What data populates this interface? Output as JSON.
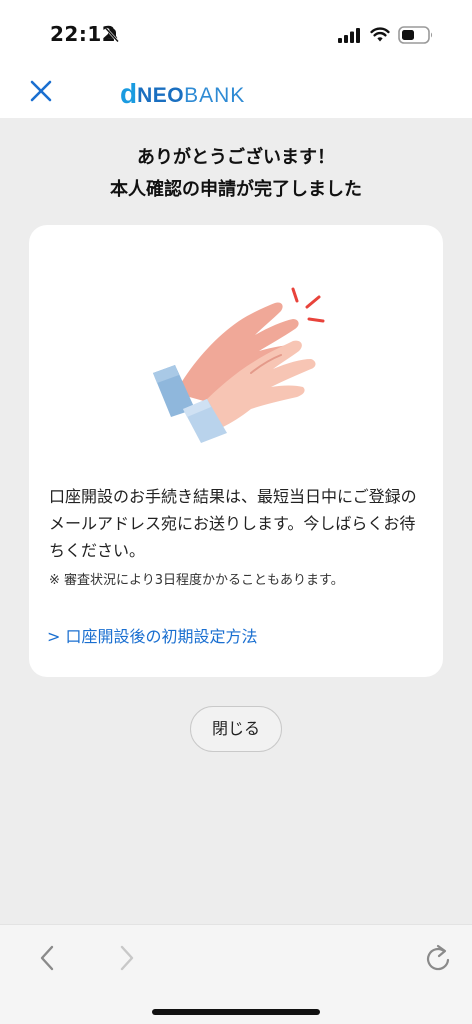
{
  "status_bar": {
    "time": "22:12",
    "icons": [
      "bell-slash-icon",
      "signal-icon",
      "wifi-icon",
      "battery-icon"
    ]
  },
  "header": {
    "close_icon": "close-icon",
    "logo": {
      "d": "d",
      "neo": "NEO",
      "bank": "BANK"
    }
  },
  "main": {
    "heading_line1": "ありがとうございます！",
    "heading_line2": "本人確認の申請が完了しました",
    "illustration": "clapping-hands-icon",
    "message": "口座開設のお手続き結果は、最短当日中にご登録のメールアドレス宛にお送りします。今しばらくお待ちください。",
    "note": "※ 審査状況により3日程度かかることもあります。",
    "link_label": "> 口座開設後の初期設定方法",
    "close_button_label": "閉じる"
  },
  "toolbar": {
    "icons": [
      "back-icon",
      "forward-icon",
      "refresh-icon"
    ]
  },
  "colors": {
    "accent": "#1a6fd0",
    "background": "#ededed",
    "logo_blue": "#1a9be0"
  }
}
